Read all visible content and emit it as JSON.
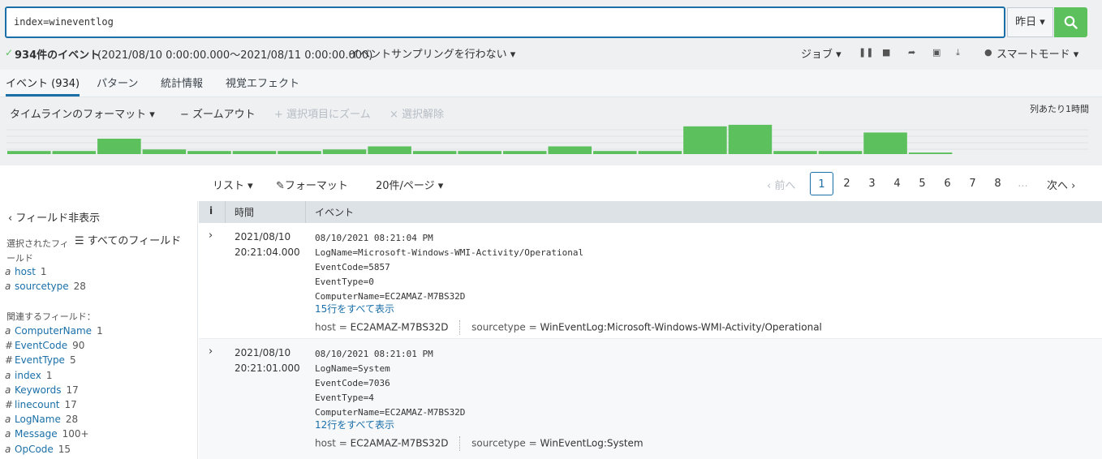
{
  "search": {
    "query": "index=wineventlog",
    "time_range": "昨日 ▾"
  },
  "status": {
    "check": "✓",
    "count": "934件のイベント",
    "range": "(2021/08/10 0:00:00.000〜2021/08/11 0:00:00.000)",
    "sampling": "イベントサンプリングを行わない ▾",
    "job": "ジョブ ▾",
    "mode": "スマートモード ▾"
  },
  "tabs": [
    {
      "label": "イベント (934)"
    },
    {
      "label": "パターン"
    },
    {
      "label": "統計情報"
    },
    {
      "label": "視覚エフェクト"
    }
  ],
  "timeline": {
    "format": "タイムラインのフォーマット ▾",
    "zoom_out": "− ズームアウト",
    "zoom_selection": "+ 選択項目にズーム",
    "deselect": "× 選択解除",
    "scale": "列あたり1時間",
    "bars": [
      1,
      1,
      5,
      1.5,
      1,
      1,
      1,
      1.5,
      2.5,
      1,
      1,
      1,
      2.5,
      1,
      1,
      9,
      9.5,
      1,
      1,
      7,
      0.5,
      0,
      0,
      0
    ],
    "bar_color": "#5cc05c"
  },
  "pager": {
    "list": "リスト ▾",
    "format": "フォーマット",
    "per_page": "20件/ページ ▾",
    "prev": "‹ 前へ",
    "next": "次へ ›",
    "pages": [
      "1",
      "2",
      "3",
      "4",
      "5",
      "6",
      "7",
      "8",
      "..."
    ],
    "current": "1"
  },
  "sidebar": {
    "hide": "‹ フィールド非表示",
    "all_fields": "☰ すべてのフィールド",
    "selected_title": "選択されたフィールド",
    "selected": [
      {
        "type": "a",
        "name": "host",
        "count": "1"
      },
      {
        "type": "a",
        "name": "sourcetype",
        "count": "28"
      }
    ],
    "related_title": "関連するフィールド：",
    "related": [
      {
        "type": "a",
        "name": "ComputerName",
        "count": "1"
      },
      {
        "type": "#",
        "name": "EventCode",
        "count": "90"
      },
      {
        "type": "#",
        "name": "EventType",
        "count": "5"
      },
      {
        "type": "a",
        "name": "index",
        "count": "1"
      },
      {
        "type": "a",
        "name": "Keywords",
        "count": "17"
      },
      {
        "type": "#",
        "name": "linecount",
        "count": "17"
      },
      {
        "type": "a",
        "name": "LogName",
        "count": "28"
      },
      {
        "type": "a",
        "name": "Message",
        "count": "100+"
      },
      {
        "type": "a",
        "name": "OpCode",
        "count": "15"
      }
    ]
  },
  "table": {
    "headers": [
      "i",
      "時間",
      "イベント"
    ],
    "events": [
      {
        "date": "2021/08/10",
        "time": "20:21:04.000",
        "lines": [
          "08/10/2021 08:21:04 PM",
          "LogName=Microsoft-Windows-WMI-Activity/Operational",
          "EventCode=5857",
          "EventType=0",
          "ComputerName=EC2AMAZ-M7BS32D"
        ],
        "more": "15行をすべて表示",
        "host_label": "host =",
        "host": "EC2AMAZ-M7BS32D",
        "sourcetype_label": "sourcetype =",
        "sourcetype": "WinEventLog:Microsoft-Windows-WMI-Activity/Operational"
      },
      {
        "date": "2021/08/10",
        "time": "20:21:01.000",
        "lines": [
          "08/10/2021 08:21:01 PM",
          "LogName=System",
          "EventCode=7036",
          "EventType=4",
          "ComputerName=EC2AMAZ-M7BS32D"
        ],
        "more": "12行をすべて表示",
        "host_label": "host =",
        "host": "EC2AMAZ-M7BS32D",
        "sourcetype_label": "sourcetype =",
        "sourcetype": "WinEventLog:System"
      }
    ]
  }
}
